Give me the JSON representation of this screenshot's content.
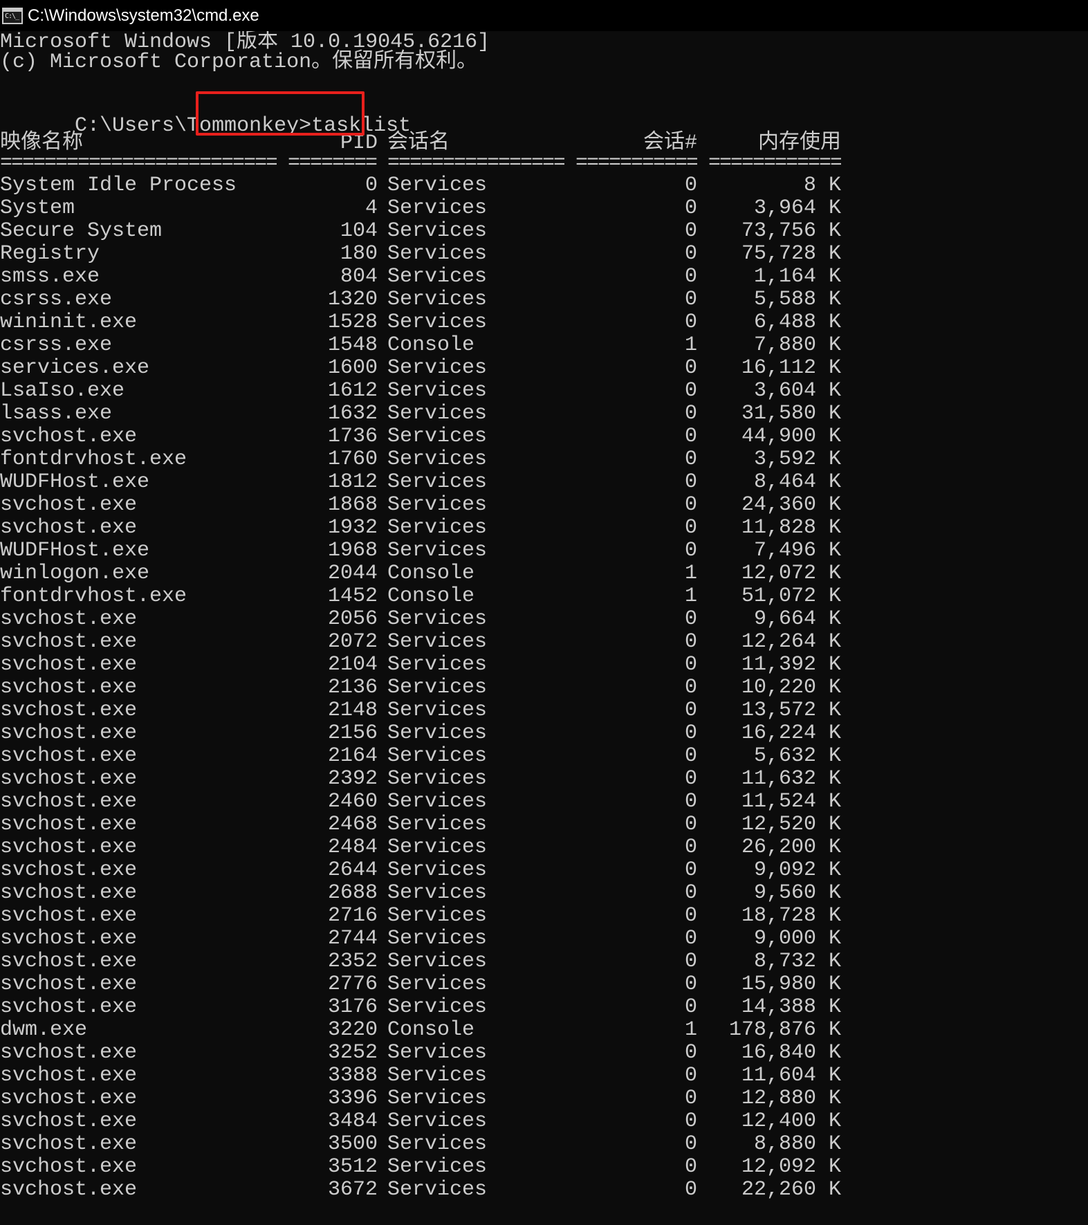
{
  "window": {
    "title": "C:\\Windows\\system32\\cmd.exe",
    "icon_label": "C:\\_",
    "icon": "cmd-icon"
  },
  "banner": {
    "line1": "Microsoft Windows [版本 10.0.19045.6216]",
    "line2": "(c) Microsoft Corporation。保留所有权利。"
  },
  "prompt": {
    "path": "C:\\Users\\Tommonkey",
    "command": ">tasklist"
  },
  "table": {
    "headers": {
      "name": "映像名称",
      "pid": "PID",
      "session_name": "会话名",
      "session_num": "会话#",
      "mem": "内存使用"
    },
    "separators": {
      "name": "=========================",
      "pid": "========",
      "session_name": "================",
      "session_num": "===========",
      "mem": "============"
    },
    "rows": [
      {
        "name": "System Idle Process",
        "pid": "0",
        "session": "Services",
        "num": "0",
        "mem": "8 K"
      },
      {
        "name": "System",
        "pid": "4",
        "session": "Services",
        "num": "0",
        "mem": "3,964 K"
      },
      {
        "name": "Secure System",
        "pid": "104",
        "session": "Services",
        "num": "0",
        "mem": "73,756 K"
      },
      {
        "name": "Registry",
        "pid": "180",
        "session": "Services",
        "num": "0",
        "mem": "75,728 K"
      },
      {
        "name": "smss.exe",
        "pid": "804",
        "session": "Services",
        "num": "0",
        "mem": "1,164 K"
      },
      {
        "name": "csrss.exe",
        "pid": "1320",
        "session": "Services",
        "num": "0",
        "mem": "5,588 K"
      },
      {
        "name": "wininit.exe",
        "pid": "1528",
        "session": "Services",
        "num": "0",
        "mem": "6,488 K"
      },
      {
        "name": "csrss.exe",
        "pid": "1548",
        "session": "Console",
        "num": "1",
        "mem": "7,880 K"
      },
      {
        "name": "services.exe",
        "pid": "1600",
        "session": "Services",
        "num": "0",
        "mem": "16,112 K"
      },
      {
        "name": "LsaIso.exe",
        "pid": "1612",
        "session": "Services",
        "num": "0",
        "mem": "3,604 K"
      },
      {
        "name": "lsass.exe",
        "pid": "1632",
        "session": "Services",
        "num": "0",
        "mem": "31,580 K"
      },
      {
        "name": "svchost.exe",
        "pid": "1736",
        "session": "Services",
        "num": "0",
        "mem": "44,900 K"
      },
      {
        "name": "fontdrvhost.exe",
        "pid": "1760",
        "session": "Services",
        "num": "0",
        "mem": "3,592 K"
      },
      {
        "name": "WUDFHost.exe",
        "pid": "1812",
        "session": "Services",
        "num": "0",
        "mem": "8,464 K"
      },
      {
        "name": "svchost.exe",
        "pid": "1868",
        "session": "Services",
        "num": "0",
        "mem": "24,360 K"
      },
      {
        "name": "svchost.exe",
        "pid": "1932",
        "session": "Services",
        "num": "0",
        "mem": "11,828 K"
      },
      {
        "name": "WUDFHost.exe",
        "pid": "1968",
        "session": "Services",
        "num": "0",
        "mem": "7,496 K"
      },
      {
        "name": "winlogon.exe",
        "pid": "2044",
        "session": "Console",
        "num": "1",
        "mem": "12,072 K"
      },
      {
        "name": "fontdrvhost.exe",
        "pid": "1452",
        "session": "Console",
        "num": "1",
        "mem": "51,072 K"
      },
      {
        "name": "svchost.exe",
        "pid": "2056",
        "session": "Services",
        "num": "0",
        "mem": "9,664 K"
      },
      {
        "name": "svchost.exe",
        "pid": "2072",
        "session": "Services",
        "num": "0",
        "mem": "12,264 K"
      },
      {
        "name": "svchost.exe",
        "pid": "2104",
        "session": "Services",
        "num": "0",
        "mem": "11,392 K"
      },
      {
        "name": "svchost.exe",
        "pid": "2136",
        "session": "Services",
        "num": "0",
        "mem": "10,220 K"
      },
      {
        "name": "svchost.exe",
        "pid": "2148",
        "session": "Services",
        "num": "0",
        "mem": "13,572 K"
      },
      {
        "name": "svchost.exe",
        "pid": "2156",
        "session": "Services",
        "num": "0",
        "mem": "16,224 K"
      },
      {
        "name": "svchost.exe",
        "pid": "2164",
        "session": "Services",
        "num": "0",
        "mem": "5,632 K"
      },
      {
        "name": "svchost.exe",
        "pid": "2392",
        "session": "Services",
        "num": "0",
        "mem": "11,632 K"
      },
      {
        "name": "svchost.exe",
        "pid": "2460",
        "session": "Services",
        "num": "0",
        "mem": "11,524 K"
      },
      {
        "name": "svchost.exe",
        "pid": "2468",
        "session": "Services",
        "num": "0",
        "mem": "12,520 K"
      },
      {
        "name": "svchost.exe",
        "pid": "2484",
        "session": "Services",
        "num": "0",
        "mem": "26,200 K"
      },
      {
        "name": "svchost.exe",
        "pid": "2644",
        "session": "Services",
        "num": "0",
        "mem": "9,092 K"
      },
      {
        "name": "svchost.exe",
        "pid": "2688",
        "session": "Services",
        "num": "0",
        "mem": "9,560 K"
      },
      {
        "name": "svchost.exe",
        "pid": "2716",
        "session": "Services",
        "num": "0",
        "mem": "18,728 K"
      },
      {
        "name": "svchost.exe",
        "pid": "2744",
        "session": "Services",
        "num": "0",
        "mem": "9,000 K"
      },
      {
        "name": "svchost.exe",
        "pid": "2352",
        "session": "Services",
        "num": "0",
        "mem": "8,732 K"
      },
      {
        "name": "svchost.exe",
        "pid": "2776",
        "session": "Services",
        "num": "0",
        "mem": "15,980 K"
      },
      {
        "name": "svchost.exe",
        "pid": "3176",
        "session": "Services",
        "num": "0",
        "mem": "14,388 K"
      },
      {
        "name": "dwm.exe",
        "pid": "3220",
        "session": "Console",
        "num": "1",
        "mem": "178,876 K"
      },
      {
        "name": "svchost.exe",
        "pid": "3252",
        "session": "Services",
        "num": "0",
        "mem": "16,840 K"
      },
      {
        "name": "svchost.exe",
        "pid": "3388",
        "session": "Services",
        "num": "0",
        "mem": "11,604 K"
      },
      {
        "name": "svchost.exe",
        "pid": "3396",
        "session": "Services",
        "num": "0",
        "mem": "12,880 K"
      },
      {
        "name": "svchost.exe",
        "pid": "3484",
        "session": "Services",
        "num": "0",
        "mem": "12,400 K"
      },
      {
        "name": "svchost.exe",
        "pid": "3500",
        "session": "Services",
        "num": "0",
        "mem": "8,880 K"
      },
      {
        "name": "svchost.exe",
        "pid": "3512",
        "session": "Services",
        "num": "0",
        "mem": "12,092 K"
      },
      {
        "name": "svchost.exe",
        "pid": "3672",
        "session": "Services",
        "num": "0",
        "mem": "22,260 K"
      }
    ]
  },
  "colors": {
    "background": "#0c0c0c",
    "text": "#cccccc",
    "titlebar": "#000000",
    "highlight": "#e8201c"
  }
}
